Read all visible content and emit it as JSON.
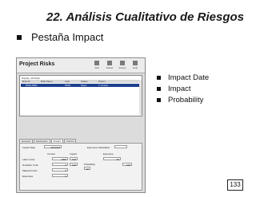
{
  "slide": {
    "title": "22. Análisis Cualitativo de Riesgos",
    "bullet": "Pestaña Impact",
    "sub_bullets": [
      "Impact Date",
      "Impact",
      "Probability"
    ],
    "page_number": "133"
  },
  "screenshot": {
    "window_title": "Project Risks",
    "toolbar": [
      {
        "label": "Add"
      },
      {
        "label": "Delete"
      },
      {
        "label": "Assign"
      },
      {
        "label": "Help"
      }
    ],
    "grid": {
      "caption": "Display: All Risks",
      "columns": [
        "Risk ID",
        "Risk Name",
        "Calc",
        "Status",
        "Owner"
      ],
      "selected_row": [
        "",
        "RISK-0001",
        "P0S1",
        "Open",
        "T. Arnold"
      ]
    },
    "tabs": [
      "General",
      "Description",
      "Impact",
      "Control"
    ],
    "active_tab": "Impact",
    "panel": {
      "impact_date_label": "Impact Date",
      "impact_date_value": "09/10/00",
      "exposure_label": "Exposure Calculation",
      "col_current": "Current",
      "col_impact": "Impact",
      "col_exposure": "Exposure",
      "rows": [
        {
          "label": "Labor Units",
          "current": "1000",
          "impact": "100"
        },
        {
          "label": "Nonlabor Units",
          "current": "0",
          "impact": "100"
        },
        {
          "label": "Material Units",
          "current": "0",
          "impact": ""
        },
        {
          "label": "Expenses",
          "current": "0",
          "impact": ""
        }
      ],
      "probability_label": "Probability",
      "probability_value": "20",
      "result_value": "20",
      "impact_value": "100"
    }
  }
}
